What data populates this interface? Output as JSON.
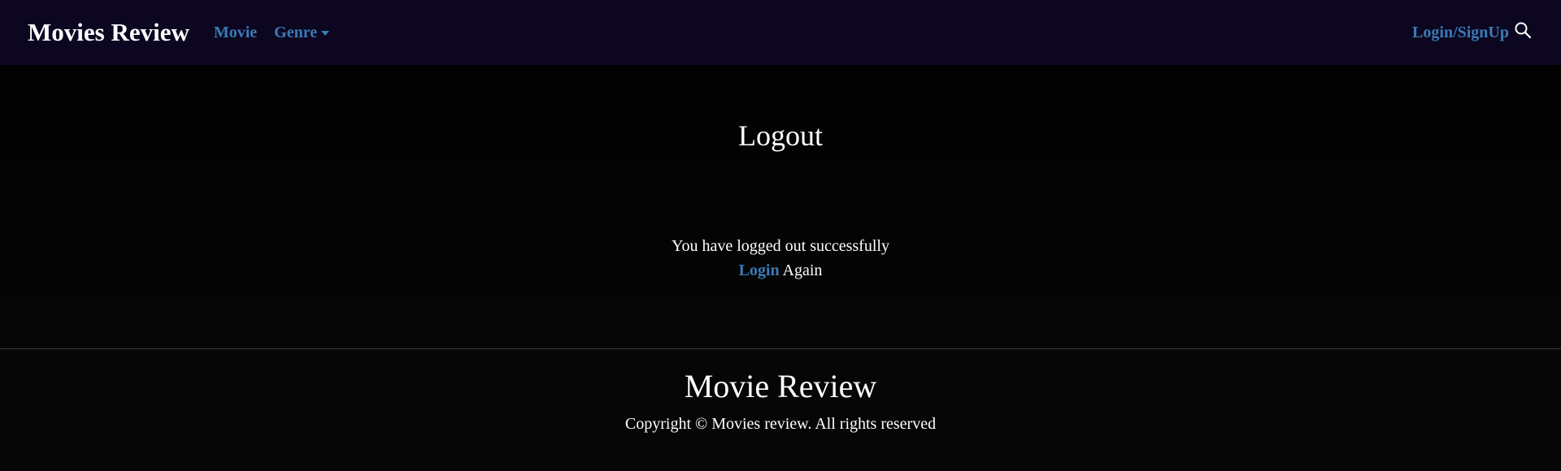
{
  "navbar": {
    "brand": "Movies Review",
    "movie_link": "Movie",
    "genre_link": "Genre",
    "login_link": "Login/SignUp"
  },
  "main": {
    "title": "Logout",
    "message": "You have logged out successfully",
    "login_link": "Login",
    "again_text": " Again"
  },
  "footer": {
    "title": "Movie Review",
    "copyright": "Copyright © Movies review. All rights reserved"
  },
  "colors": {
    "navbar_bg": "#0c0620",
    "link": "#3a7bb5",
    "page_bg": "#050505"
  },
  "icons": {
    "search": "search-icon",
    "genre_caret": "caret-down-icon"
  }
}
